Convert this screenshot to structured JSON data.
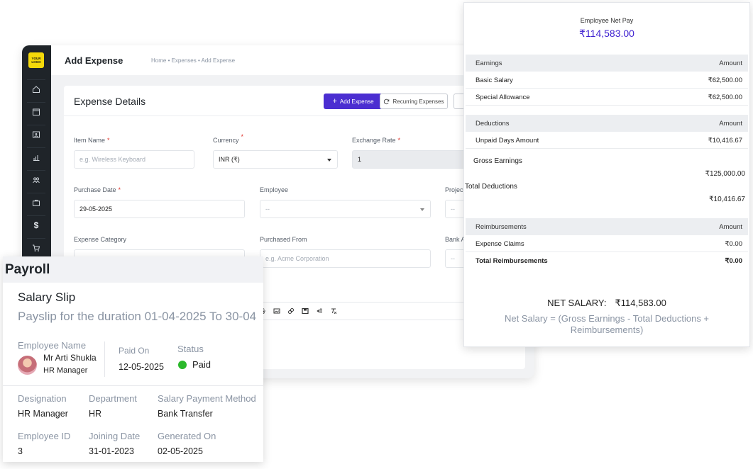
{
  "expense": {
    "logo_text": "YOUR LOGO",
    "sidebar_dollar": "$",
    "page_title": "Add Expense",
    "breadcrumb": "Home • Expenses • Add Expense",
    "card_title": "Expense Details",
    "add_button": "Add Expense",
    "recurring_button": "Recurring Expenses",
    "fields": {
      "item_name": {
        "label": "Item Name",
        "placeholder": "e.g. Wireless Keyboard"
      },
      "currency": {
        "label": "Currency",
        "value": "INR (₹)"
      },
      "exchange_rate": {
        "label": "Exchange Rate",
        "value": "1"
      },
      "purchase_date": {
        "label": "Purchase Date",
        "value": "29-05-2025"
      },
      "employee": {
        "label": "Employee",
        "value": "--"
      },
      "project": {
        "label": "Projec",
        "value": "--"
      },
      "expense_category": {
        "label": "Expense Category"
      },
      "purchased_from": {
        "label": "Purchased From",
        "placeholder": "e.g. Acme Corporation"
      },
      "bank": {
        "label": "Bank A",
        "value": "--"
      }
    },
    "required_mark": "*"
  },
  "payslip": {
    "net_pay_label": "Employee Net Pay",
    "net_pay_value": "₹114,583.00",
    "earnings": {
      "head": "Earnings",
      "amount_head": "Amount",
      "rows": [
        {
          "label": "Basic Salary",
          "amount": "₹62,500.00"
        },
        {
          "label": "Special Allowance",
          "amount": "₹62,500.00"
        }
      ]
    },
    "deductions": {
      "head": "Deductions",
      "amount_head": "Amount",
      "rows": [
        {
          "label": "Unpaid Days Amount",
          "amount": "₹10,416.67"
        }
      ]
    },
    "gross_earnings": {
      "label": "Gross Earnings",
      "value": "₹125,000.00"
    },
    "total_deductions": {
      "label": "Total Deductions",
      "value": "₹10,416.67"
    },
    "reimbursements": {
      "head": "Reimbursements",
      "amount_head": "Amount",
      "rows": [
        {
          "label": "Expense Claims",
          "amount": "₹0.00"
        }
      ],
      "total_label": "Total Reimbursements",
      "total_value": "₹0.00"
    },
    "net_salary_label": "NET SALARY:",
    "net_salary_value": "₹114,583.00",
    "formula_line1": "Net Salary = (Gross Earnings - Total Deductions +",
    "formula_line2": "Reimbursements)"
  },
  "payroll": {
    "header": "Payroll",
    "title": "Salary Slip",
    "subtitle": "Payslip for the duration 01-04-2025 To 30-04",
    "employee_name_label": "Employee Name",
    "employee_name": "Mr Arti Shukla",
    "employee_role": "HR Manager",
    "paid_on_label": "Paid On",
    "paid_on": "12-05-2025",
    "status_label": "Status",
    "status": "Paid",
    "designation_label": "Designation",
    "designation": "HR Manager",
    "department_label": "Department",
    "department": "HR",
    "payment_method_label": "Salary Payment Method",
    "payment_method": "Bank Transfer",
    "employee_id_label": "Employee ID",
    "employee_id": "3",
    "joining_date_label": "Joining Date",
    "joining_date": "31-01-2023",
    "generated_on_label": "Generated On",
    "generated_on": "02-05-2025"
  },
  "colors": {
    "accent": "#4b2ed1",
    "net_pay": "#3d1fd0",
    "paid": "#2bb82b",
    "sidebar": "#1f2429"
  }
}
